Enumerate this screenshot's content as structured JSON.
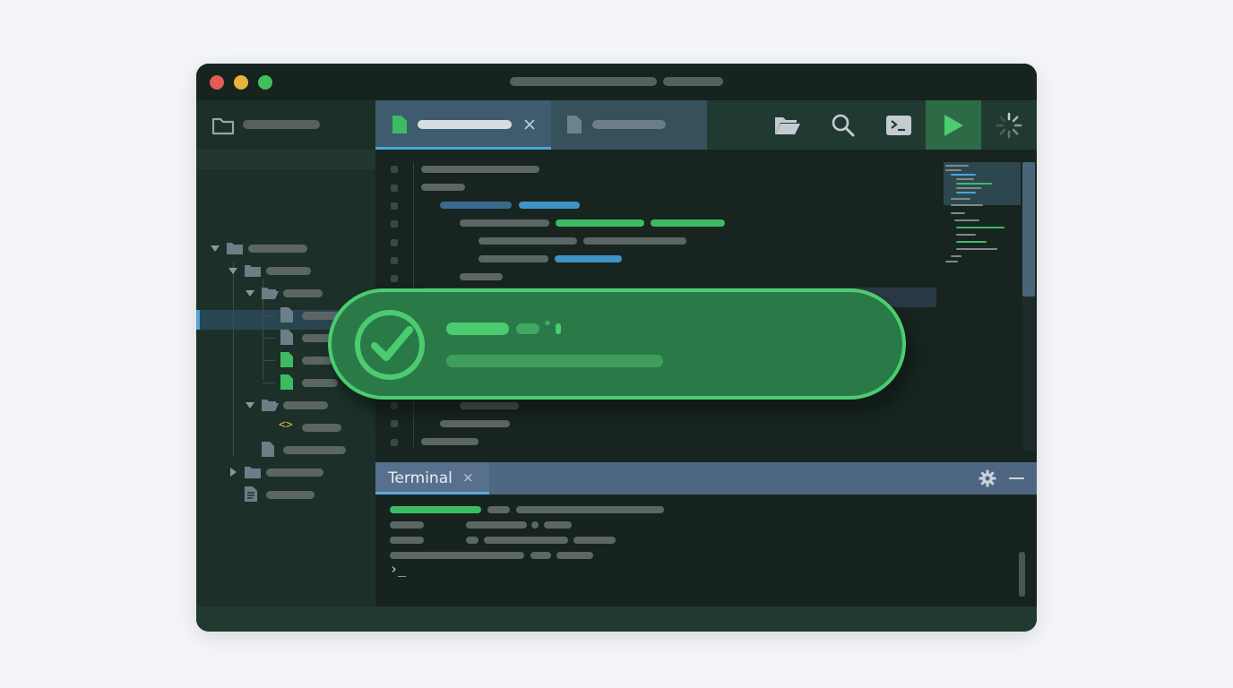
{
  "window": {
    "controls": [
      "close",
      "minimize",
      "maximize"
    ],
    "colors": {
      "close": "#e55b55",
      "minimize": "#e6b33b",
      "maximize": "#3fbf5b"
    }
  },
  "toolbar": {
    "icons": [
      "open-folder-icon",
      "search-icon",
      "terminal-icon",
      "run-icon",
      "spinner-icon"
    ]
  },
  "terminal": {
    "tab_label": "Terminal",
    "close_glyph": "×",
    "prompt": "›_"
  },
  "toast": {
    "status": "success",
    "icon": "check-circle-icon",
    "accent": "#4ccc70"
  },
  "colors": {
    "accent_blue": "#4ba7d6",
    "code_green": "#3dbb63",
    "code_blue": "#3f93c9"
  }
}
